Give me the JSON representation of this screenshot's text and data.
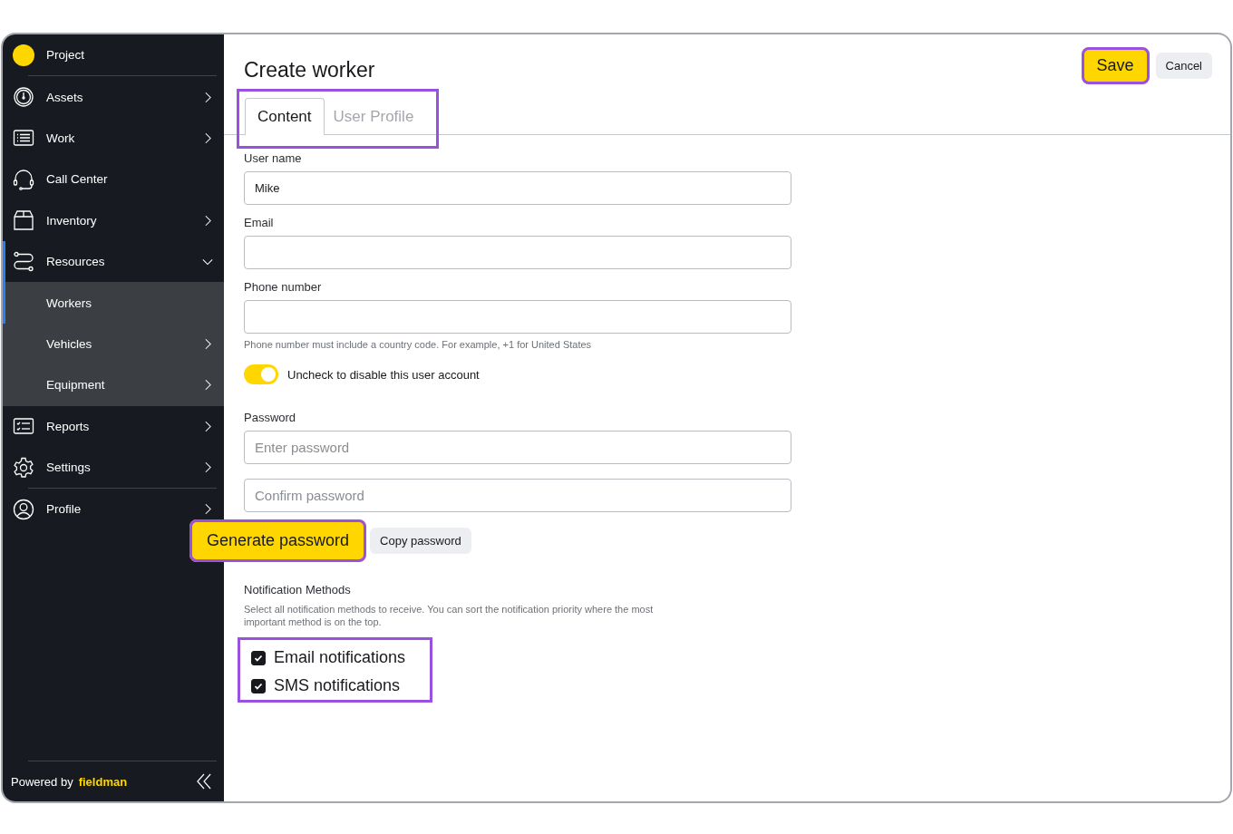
{
  "sidebar": {
    "sections": [
      [
        {
          "label": "Project",
          "kind": "project"
        }
      ],
      [
        {
          "label": "Assets",
          "kind": "item",
          "expanded": false,
          "selected": false
        },
        {
          "label": "Work",
          "kind": "item",
          "expanded": false,
          "selected": false
        },
        {
          "label": "Call Center",
          "kind": "item",
          "selected": false
        },
        {
          "label": "Inventory",
          "kind": "item",
          "expanded": false,
          "selected": false
        },
        {
          "label": "Resources",
          "kind": "item",
          "expanded": true,
          "selected": true,
          "children": [
            {
              "label": "Workers",
              "selected": true
            },
            {
              "label": "Vehicles",
              "selected": false,
              "expanded": false
            },
            {
              "label": "Equipment",
              "selected": false,
              "expanded": false
            }
          ]
        },
        {
          "label": "Reports",
          "kind": "item",
          "expanded": false,
          "selected": false
        },
        {
          "label": "Settings",
          "kind": "item",
          "expanded": false,
          "selected": false
        }
      ],
      [
        {
          "label": "Profile",
          "kind": "item",
          "expanded": false,
          "selected": false
        }
      ]
    ],
    "footer": {
      "prefix": "Powered by",
      "brand": "fieldman"
    }
  },
  "page": {
    "title": "Create worker",
    "save": {
      "label": "Save",
      "highlighted": true
    },
    "cancel": {
      "label": "Cancel"
    },
    "tabs_highlighted": true,
    "tabs": [
      {
        "label": "Content",
        "selected": true
      },
      {
        "label": "User Profile",
        "selected": false
      }
    ]
  },
  "form": {
    "fields": [
      {
        "label": "User name",
        "value": "Mike"
      },
      {
        "label": "Email"
      },
      {
        "label": "Phone number",
        "hint": "Phone number must include a country code. For example, +1 for United States"
      }
    ],
    "account_toggle": {
      "label": "Uncheck to disable this user account",
      "on": true
    },
    "password": {
      "label": "Password",
      "fields": [
        {
          "placeholder": "Enter password"
        },
        {
          "placeholder": "Confirm password"
        }
      ]
    },
    "generate": {
      "label": "Generate password",
      "highlighted": true
    },
    "copy": {
      "label": "Copy password"
    },
    "notifications": {
      "title": "Notification Methods",
      "description": "Select all notification methods to receive. You can sort the notification priority where the most important method is on the top.",
      "highlighted": true,
      "options": [
        {
          "label": "Email notifications",
          "checked": true
        },
        {
          "label": "SMS notifications",
          "checked": true
        }
      ]
    }
  }
}
